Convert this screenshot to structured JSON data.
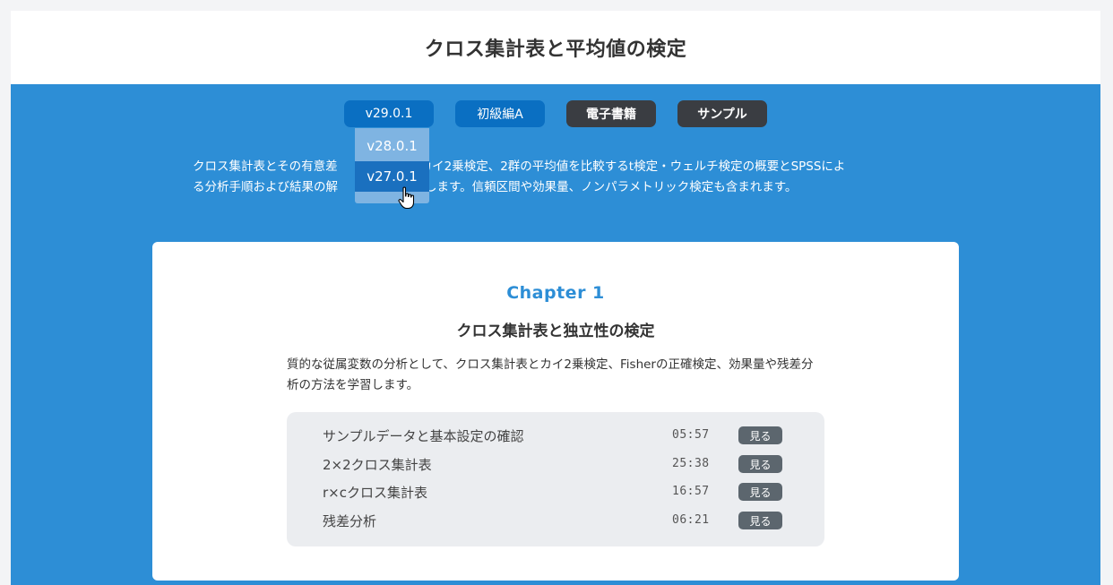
{
  "header": {
    "title": "クロス集計表と平均値の検定"
  },
  "tags": [
    {
      "label": "v29.0.1",
      "style": "blue"
    },
    {
      "label": "初級編A",
      "style": "blue"
    },
    {
      "label": "電子書籍",
      "style": "dark"
    },
    {
      "label": "サンプル",
      "style": "dark"
    }
  ],
  "version_dropdown": {
    "options": [
      {
        "label": "v28.0.1",
        "hovered": false
      },
      {
        "label": "v27.0.1",
        "hovered": true
      }
    ]
  },
  "intro": {
    "line1": "クロス集計表とその有意差",
    "line1b": "カイ2乗検定、2群の平均値を比較するt検定・ウェルチ検定の概要とSPSSによ",
    "line2": "る分析手順および結果の解",
    "line2b": "学習します。信頼区間や効果量、ノンパラメトリック検定も含まれます。"
  },
  "chapter": {
    "number_label": "Chapter 1",
    "title": "クロス集計表と独立性の検定",
    "description": "質的な従属変数の分析として、クロス集計表とカイ2乗検定、Fisherの正確検定、効果量や残差分析の方法を学習します。",
    "watch_label": "見る",
    "lessons": [
      {
        "title": "サンプルデータと基本設定の確認",
        "duration": "05:57"
      },
      {
        "title": "2×2クロス集計表",
        "duration": "25:38"
      },
      {
        "title": "r×cクロス集計表",
        "duration": "16:57"
      },
      {
        "title": "残差分析",
        "duration": "06:21"
      }
    ]
  },
  "colors": {
    "background_blue": "#2d8ed6",
    "pill_blue": "#0a6fc2",
    "pill_dark": "#3a3d42",
    "dropdown": "#7fb4e2",
    "dropdown_hover": "#1a70bf",
    "watch_button": "#5c666e"
  }
}
